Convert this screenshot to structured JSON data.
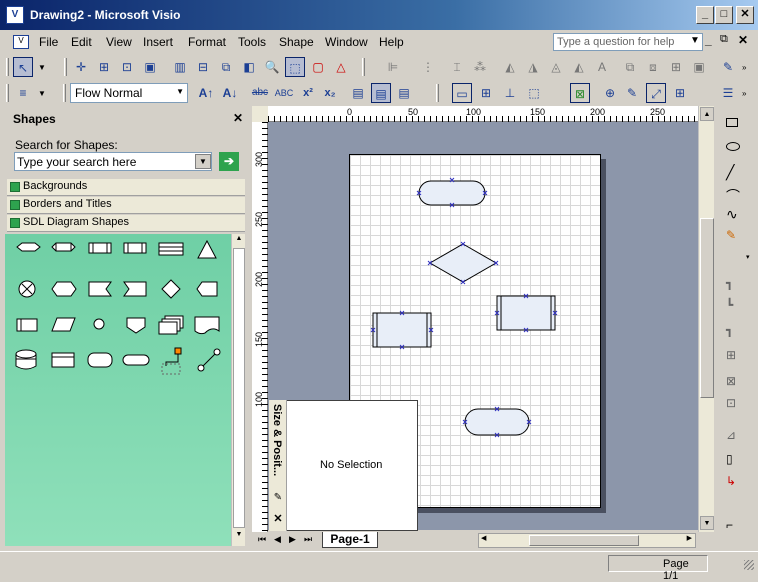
{
  "window": {
    "title": "Drawing2 - Microsoft Visio",
    "app_icon_label": "V"
  },
  "menu": {
    "items": [
      "File",
      "Edit",
      "View",
      "Insert",
      "Format",
      "Tools",
      "Shape",
      "Window",
      "Help"
    ],
    "help_placeholder": "Type a question for help"
  },
  "format_toolbar": {
    "style_value": "Flow Normal"
  },
  "shapes_panel": {
    "title": "Shapes",
    "search_label": "Search for Shapes:",
    "search_placeholder": "Type your search here",
    "stencils": [
      "Backgrounds",
      "Borders and Titles",
      "SDL Diagram Shapes"
    ]
  },
  "ruler": {
    "h_ticks": [
      "0",
      "50",
      "100",
      "150",
      "200",
      "250"
    ],
    "v_ticks": [
      "300",
      "250",
      "200",
      "150",
      "100"
    ]
  },
  "size_position": {
    "title": "Size & Posit...",
    "content": "No Selection"
  },
  "tabs": {
    "page_tab": "Page-1"
  },
  "status": {
    "page": "Page 1/1"
  },
  "colors": {
    "accent": "#0a246a",
    "stencil_bg": "#7fd8b0",
    "shape_fill": "#e8eef8"
  }
}
